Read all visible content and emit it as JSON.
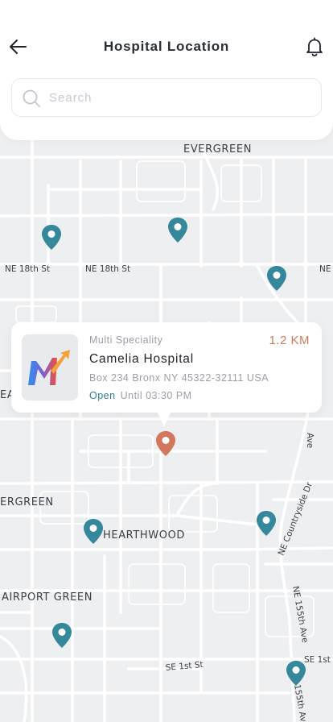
{
  "header": {
    "title": "Hospital Location",
    "back_icon": "arrow-left-icon",
    "notification_icon": "bell-icon"
  },
  "search": {
    "placeholder": "Search",
    "value": "",
    "icon": "search-icon"
  },
  "map": {
    "labels": {
      "evergreen_top": "EVERGREEN",
      "ne18_left": "NE 18th St",
      "ne18_mid": "NE 18th St",
      "ne_right": "NE",
      "ea": "EA",
      "ave": "Ave",
      "evergreen_left": "ERGREEN",
      "hearthwood": "HEARTHWOOD",
      "airport_green": "AIRPORT GREEN",
      "countryside": "NE Countryside Dr",
      "ne155_ave": "NE 155th Ave",
      "se1st_left": "SE 1st St",
      "se1st_right": "SE 1st S",
      "n155th_ave": "155th Ave"
    },
    "pin_color": "#35879b",
    "selected_pin_color": "#d2775d"
  },
  "hospital_card": {
    "category": "Multi Speciality",
    "distance": "1.2 KM",
    "name": "Camelia Hospital",
    "address": "Box 234 Bronx NY 45322-32111 USA",
    "status": "Open",
    "hours": "Until 03:30 PM",
    "accent_color": "#cd7c5c",
    "status_color": "#2f7f92"
  }
}
